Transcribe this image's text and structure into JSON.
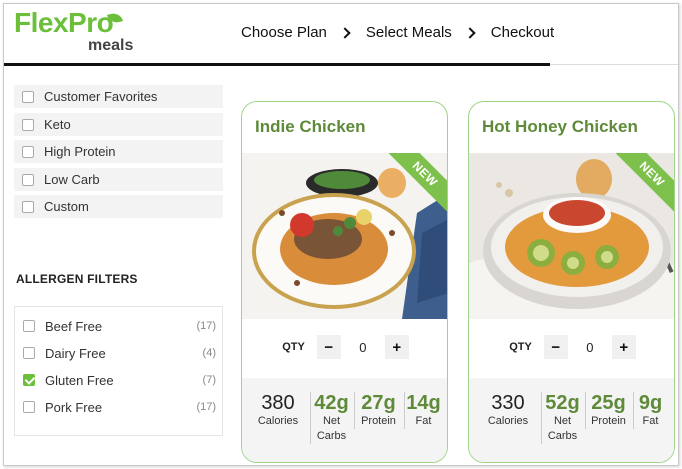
{
  "brand": {
    "logo_top": "FlexPro",
    "logo_bottom": "meals",
    "accent": "#6bbf3a"
  },
  "steps": [
    "Choose Plan",
    "Select Meals",
    "Checkout"
  ],
  "filters": [
    "Customer Favorites",
    "Keto",
    "High Protein",
    "Low Carb",
    "Custom"
  ],
  "allergen": {
    "title": "ALLERGEN FILTERS",
    "items": [
      {
        "label": "Beef Free",
        "count": "(17)",
        "checked": false
      },
      {
        "label": "Dairy Free",
        "count": "(4)",
        "checked": false
      },
      {
        "label": "Gluten Free",
        "count": "(7)",
        "checked": true
      },
      {
        "label": "Pork Free",
        "count": "(17)",
        "checked": false
      }
    ]
  },
  "meals": [
    {
      "name": "Indie Chicken",
      "badge": "NEW",
      "qty_label": "QTY",
      "qty": "0",
      "minus": "−",
      "plus": "+",
      "calories": "380",
      "calories_label": "Calories",
      "carbs": "42g",
      "carbs_label": "Net Carbs",
      "protein": "27g",
      "protein_label": "Protein",
      "fat": "14g",
      "fat_label": "Fat"
    },
    {
      "name": "Hot Honey Chicken",
      "badge": "NEW",
      "qty_label": "QTY",
      "qty": "0",
      "minus": "−",
      "plus": "+",
      "calories": "330",
      "calories_label": "Calories",
      "carbs": "52g",
      "carbs_label": "Net Carbs",
      "protein": "25g",
      "protein_label": "Protein",
      "fat": "9g",
      "fat_label": "Fat"
    }
  ]
}
